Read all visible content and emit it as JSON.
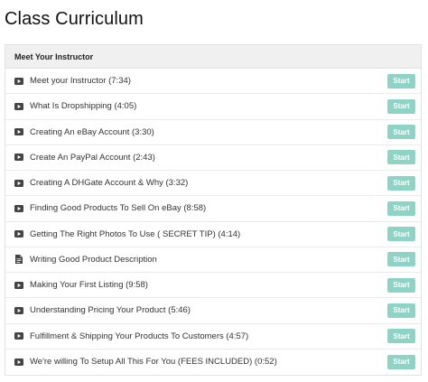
{
  "page": {
    "title": "Class Curriculum"
  },
  "section": {
    "title": "Meet Your Instructor"
  },
  "colors": {
    "start_button": "#8ed4c6",
    "section_header_bg": "#f0f0f0",
    "icon": "#444444"
  },
  "lectures": [
    {
      "title": "Meet your Instructor (7:34)",
      "icon": "video-icon",
      "action": "Start"
    },
    {
      "title": "What Is Dropshipping (4:05)",
      "icon": "video-icon",
      "action": "Start"
    },
    {
      "title": "Creating An eBay Account (3:30)",
      "icon": "video-icon",
      "action": "Start"
    },
    {
      "title": "Create An PayPal Account (2:43)",
      "icon": "video-icon",
      "action": "Start"
    },
    {
      "title": "Creating A DHGate Account & Why (3:32)",
      "icon": "video-icon",
      "action": "Start"
    },
    {
      "title": "Finding Good Products To Sell On eBay (8:58)",
      "icon": "video-icon",
      "action": "Start"
    },
    {
      "title": "Getting The Right Photos To Use ( SECRET TIP) (4:14)",
      "icon": "video-icon",
      "action": "Start"
    },
    {
      "title": "Writing Good Product Description",
      "icon": "document-icon",
      "action": "Start"
    },
    {
      "title": "Making Your First Listing (9:58)",
      "icon": "video-icon",
      "action": "Start"
    },
    {
      "title": "Understanding Pricing Your Product (5:46)",
      "icon": "video-icon",
      "action": "Start"
    },
    {
      "title": "Fulfillment & Shipping Your Products To Customers (4:57)",
      "icon": "video-icon",
      "action": "Start"
    },
    {
      "title": "We're willing To Setup All This For You (FEES INCLUDED) (0:52)",
      "icon": "video-icon",
      "action": "Start"
    }
  ]
}
